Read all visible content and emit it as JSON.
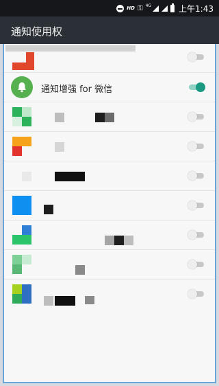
{
  "status_bar": {
    "indicators": [
      "dnd-icon",
      "HD",
      "key-icon",
      "4G",
      "signal-icon",
      "signal-icon",
      "battery-icon"
    ],
    "hd_label": "HD",
    "network_label": "4G",
    "time": "上午1:43"
  },
  "app_bar": {
    "title": "通知使用权"
  },
  "list": {
    "items": [
      {
        "label": "",
        "icon": "app-icon-red",
        "enabled": false
      },
      {
        "label": "通知增强 for 微信",
        "icon": "bell-icon",
        "enabled": true
      },
      {
        "label": "",
        "icon": "app-icon-green",
        "enabled": false
      },
      {
        "label": "",
        "icon": "app-icon-orange",
        "enabled": false
      },
      {
        "label": "",
        "icon": "app-icon-white",
        "enabled": false
      },
      {
        "label": "",
        "icon": "app-icon-blue",
        "enabled": false
      },
      {
        "label": "",
        "icon": "app-icon-green-blue",
        "enabled": false
      },
      {
        "label": "",
        "icon": "app-icon-pale-green",
        "enabled": false
      },
      {
        "label": "",
        "icon": "app-icon-multicolor",
        "enabled": false
      }
    ]
  },
  "colors": {
    "accent": "#1a9a83",
    "appbar": "#2b3036",
    "statusbar": "#15171b",
    "bell_bg": "#56b04f"
  }
}
